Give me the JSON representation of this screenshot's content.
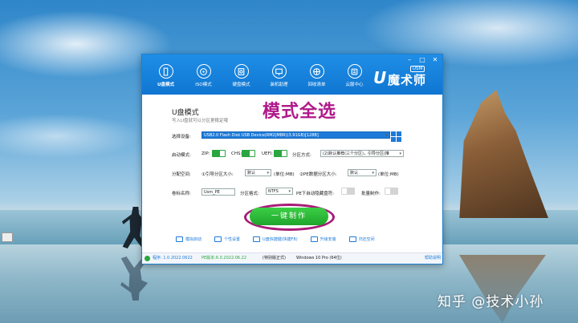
{
  "window": {
    "controls": [
      "–",
      "□",
      "✕"
    ],
    "nav": [
      {
        "label": "U盘模式",
        "icon": "usb-icon",
        "active": true
      },
      {
        "label": "ISO模式",
        "icon": "disc-icon"
      },
      {
        "label": "硬盘模式",
        "icon": "harddisk-icon"
      },
      {
        "label": "装机助理",
        "icon": "computer-icon"
      },
      {
        "label": "回收清单",
        "icon": "globe-icon"
      },
      {
        "label": "云服中心",
        "icon": "cloud-icon"
      }
    ],
    "logo": {
      "u": "U",
      "usm": "USM",
      "text": "魔术师"
    }
  },
  "mode": {
    "title": "U盘模式",
    "subtitle": "写入U盘就可以分区更稳定哦",
    "overlay": "模式全选"
  },
  "form": {
    "device_label": "选择设备:",
    "device_value": "USB2.0 Flash Disk USB Device(RM2|MBR)(3.91GB)[128B]",
    "boot_mode_label": "启动模式:",
    "zip_label": "ZIP:",
    "chs_label": "CHS:",
    "uefi_label": "UEFI:",
    "partition_method_label": "分区方式:",
    "partition_method_value": "(2)默认推荐(三个分区)，引导分区(推",
    "alloc_label": "分配空间:",
    "boot_size_label": "①引导分区大小:",
    "boot_size_value": "默认",
    "boot_size_unit": "(单位:MB)",
    "pe_size_label": "②PE数据分区大小:",
    "pe_size_value": "默认",
    "pe_size_unit": "(单位:MB)",
    "volume_label": "卷标名称:",
    "volume_value": "Usm_PE",
    "fs_label": "分区格式:",
    "fs_value": "NTFS",
    "pe_hide_label": "PE下自动隐藏盘符:",
    "batch_label": "批量制作:"
  },
  "make_button": "一键制作",
  "tools": [
    {
      "label": "模拟启动",
      "icon": "monitor-icon"
    },
    {
      "label": "个性设置",
      "icon": "shirt-icon"
    },
    {
      "label": "U盘快捷键(快捷F8)",
      "icon": "keyboard-icon"
    },
    {
      "label": "升级安装",
      "icon": "upgrade-icon"
    },
    {
      "label": "归还空间",
      "icon": "recycle-icon"
    }
  ],
  "status": {
    "version": "程序: 1.0.2022.0622",
    "pe_version": "PE版本:6.0.2022.06.22",
    "edition": "(特别版正式)",
    "os": "Windows 10 Pro (64位)",
    "help": "帮助说明"
  },
  "watermark": "知乎 @技术小孙",
  "desktop_icon_label": "..."
}
